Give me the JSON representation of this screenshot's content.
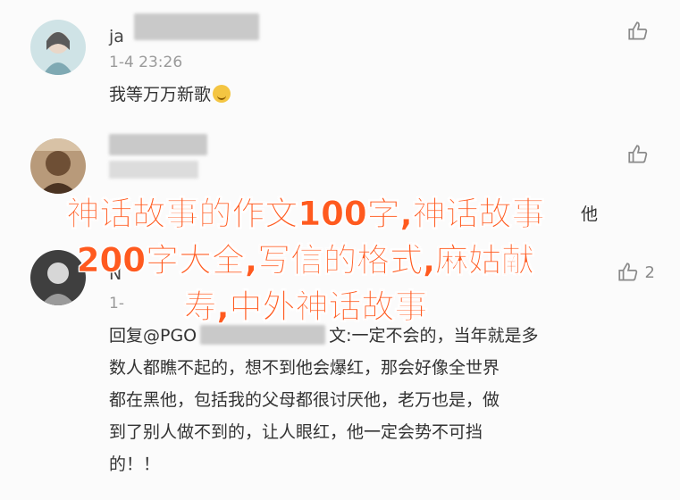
{
  "comments": [
    {
      "username": "ja",
      "timestamp": "1-4 23:26",
      "text": "我等万万新歌",
      "likes": ""
    },
    {
      "username": "",
      "timestamp": "",
      "text_tail": "他",
      "likes": ""
    },
    {
      "username": "N",
      "timestamp": "1-",
      "reply_prefix": "回复@PGO",
      "reply_rest": "文:一定不会的，当年就是多",
      "lines": [
        "数人都瞧不起的，想不到他会爆红，那会好像全世界",
        "都在黑他，包括我的父母都很讨厌他，老万也是，做",
        "到了别人做不到的，让人眼红，他一定会势不可挡",
        "的！！"
      ],
      "likes": "2"
    }
  ],
  "overlay": {
    "line1": "神话故事的作文100字,神话故事",
    "line2": "200字大全,写信的格式,麻姑献",
    "line3": "寿,中外神话故事"
  },
  "colors": {
    "overlay_text": "#ff5a1f",
    "like_icon": "#8a8a8a"
  },
  "icons": [
    "thumbs-up-icon",
    "smile-emoji-icon"
  ]
}
